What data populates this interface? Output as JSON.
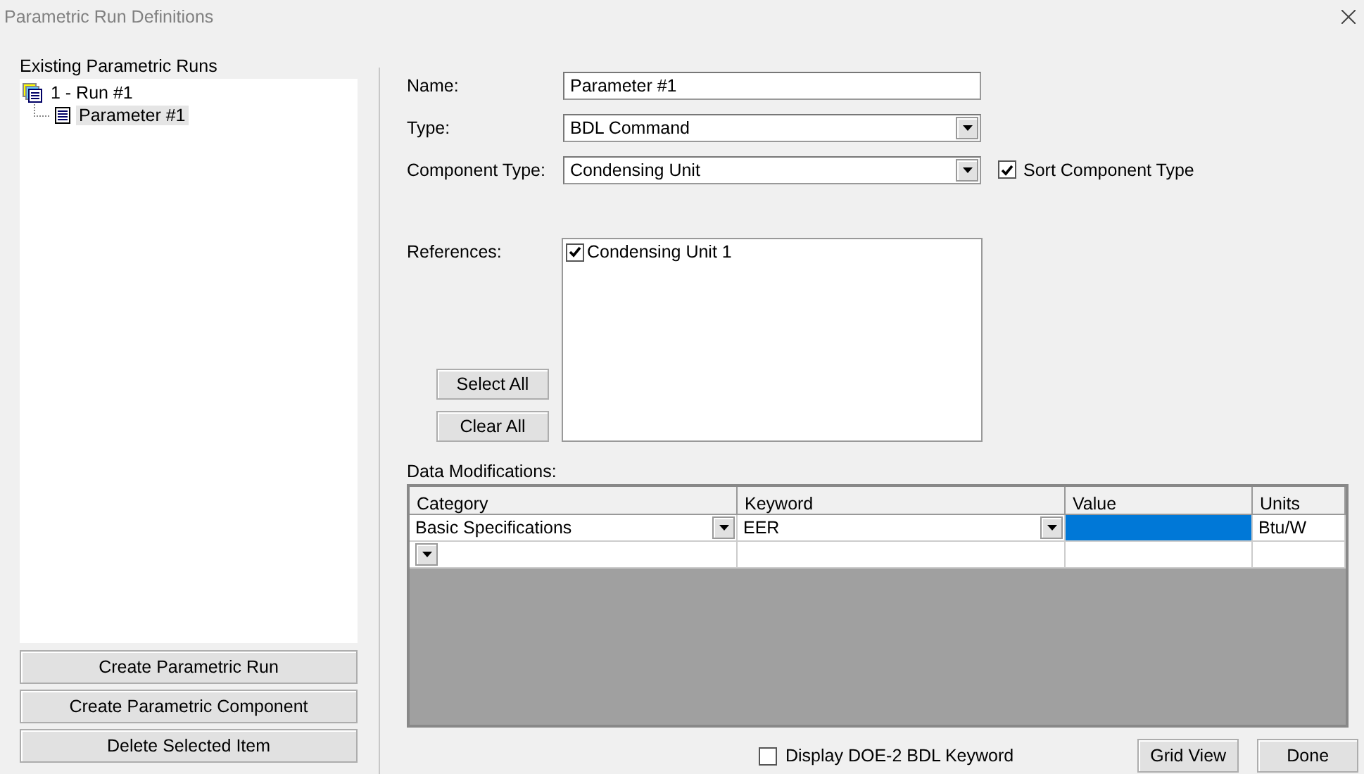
{
  "window": {
    "title": "Parametric Run Definitions"
  },
  "runs_panel": {
    "heading": "Existing Parametric Runs",
    "tree": [
      {
        "label": "1 - Run #1",
        "selected": false,
        "children": [
          {
            "label": "Parameter #1",
            "selected": true
          }
        ]
      }
    ],
    "buttons": [
      "Create Parametric Run",
      "Create Parametric Component",
      "Delete Selected Item"
    ]
  },
  "form": {
    "name": {
      "label": "Name:",
      "value": "Parameter #1"
    },
    "type": {
      "label": "Type:",
      "value": "BDL Command"
    },
    "component_type": {
      "label": "Component Type:",
      "value": "Condensing Unit"
    },
    "sort_component_type": {
      "label": "Sort Component Type",
      "checked": true
    },
    "references": {
      "label": "References:",
      "items": [
        {
          "label": "Condensing Unit 1",
          "checked": true
        }
      ],
      "buttons": [
        "Select All",
        "Clear All"
      ]
    }
  },
  "data_modifications": {
    "label": "Data Modifications:",
    "columns": [
      "Category",
      "Keyword",
      "Value",
      "Units"
    ],
    "rows": [
      {
        "category": "Basic Specifications",
        "keyword": "EER",
        "units": "Btu/W",
        "selected": true
      },
      {
        "selected": false
      }
    ]
  },
  "display_keyword": {
    "label": "Display DOE-2 BDL Keyword",
    "checked": false
  },
  "buttons": [
    "Grid View",
    "Done"
  ]
}
